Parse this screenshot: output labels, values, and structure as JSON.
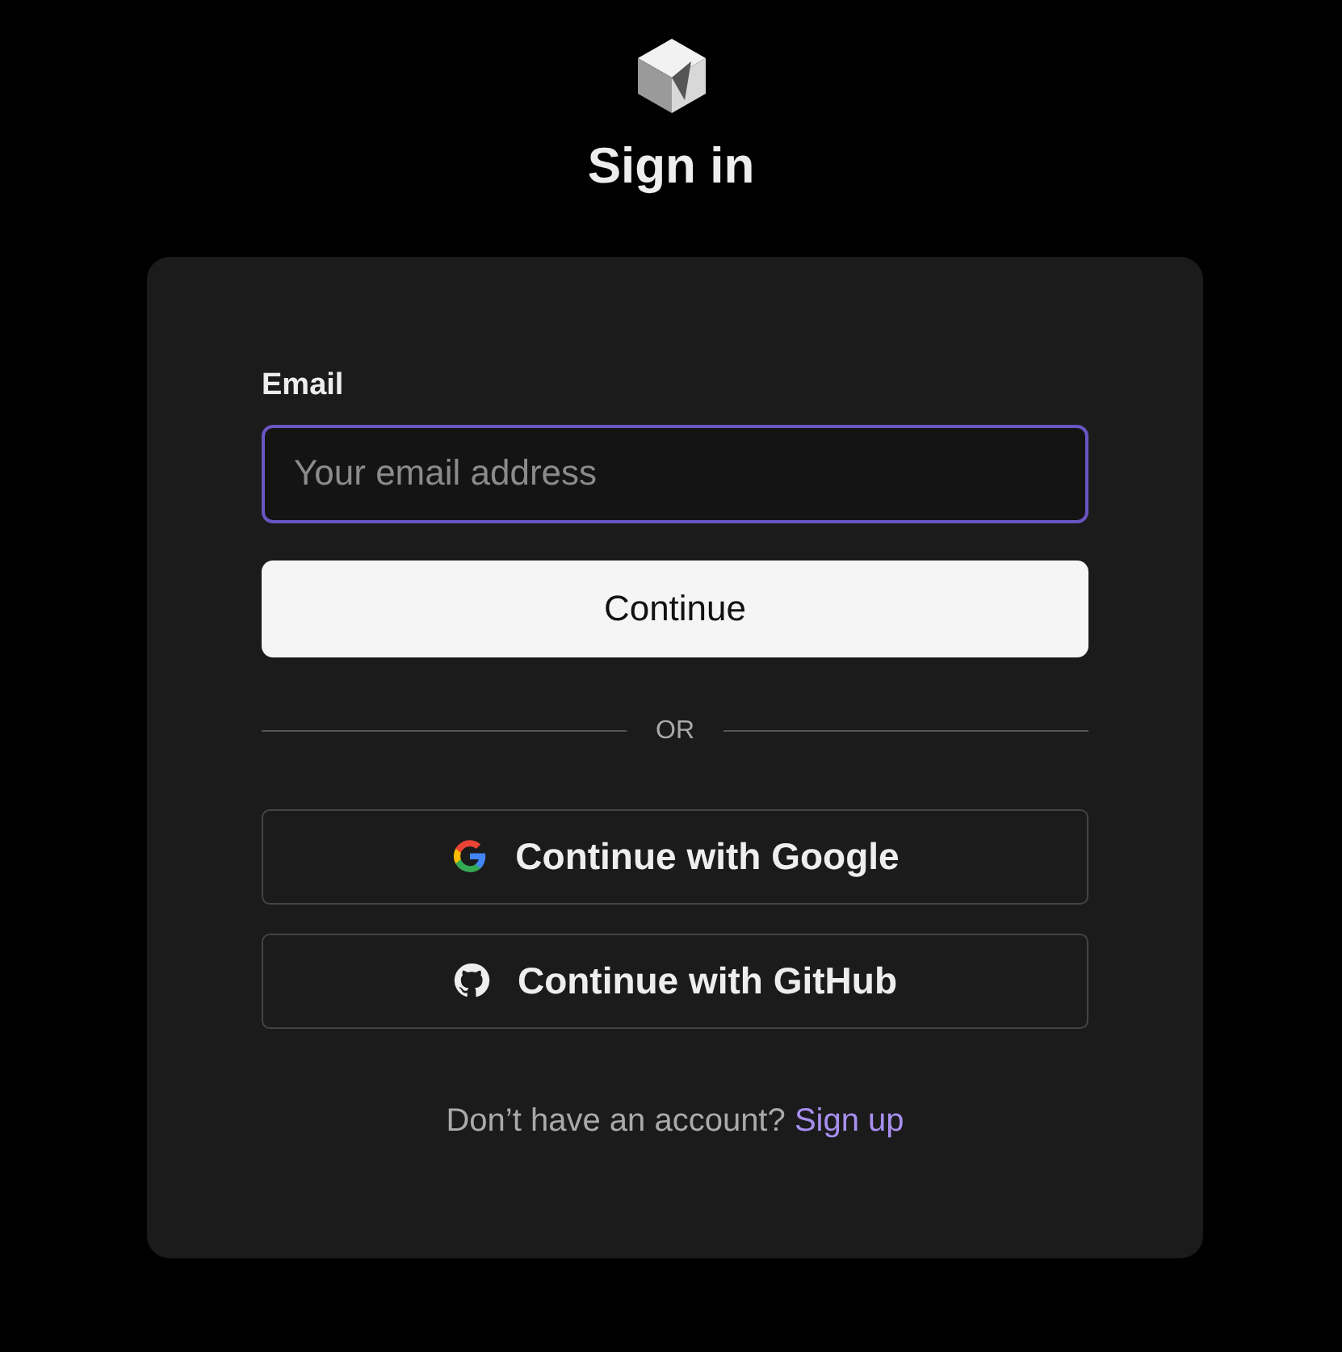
{
  "title": "Sign in",
  "email": {
    "label": "Email",
    "placeholder": "Your email address",
    "focused": true
  },
  "continue_button": "Continue",
  "divider": "OR",
  "providers": [
    {
      "kind": "google",
      "label": "Continue with Google"
    },
    {
      "kind": "github",
      "label": "Continue with GitHub"
    }
  ],
  "footer": {
    "text": "Don’t have an account?",
    "link": "Sign up"
  }
}
